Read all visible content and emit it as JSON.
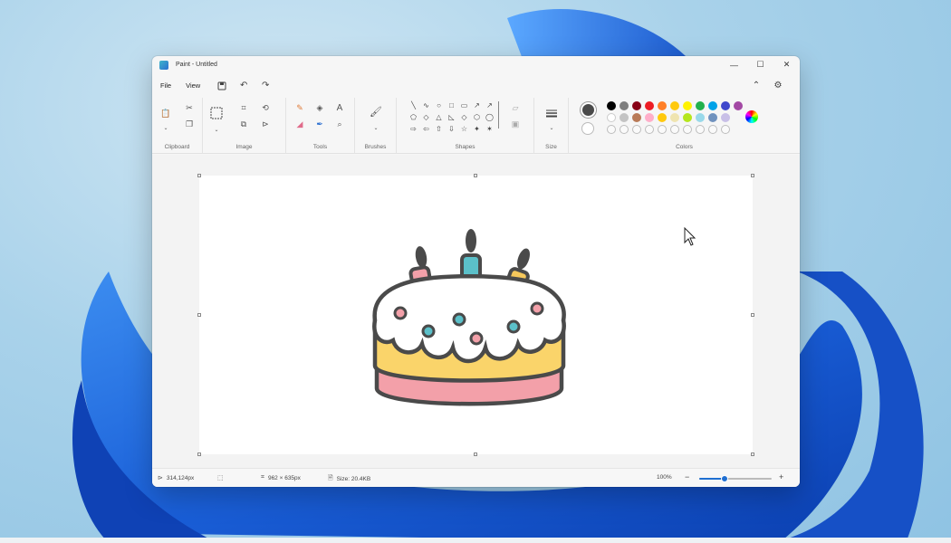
{
  "window": {
    "title": "Paint - Untitled"
  },
  "window_controls": {
    "minimize": "—",
    "maximize": "☐",
    "close": "✕"
  },
  "menu": {
    "items": [
      "File",
      "View"
    ]
  },
  "ribbon": {
    "groups": [
      "Clipboard",
      "Image",
      "Tools",
      "Brushes",
      "Shapes",
      "Size",
      "Colors"
    ],
    "shapes": [
      "╲",
      "∿",
      "○",
      "□",
      "▭",
      "↗",
      "↗",
      "⬠",
      "◇",
      "△",
      "◺",
      "◇",
      "⬡",
      "◯",
      "⇨",
      "⇦",
      "⇧",
      "⇩",
      "☆",
      "✦",
      "✶"
    ]
  },
  "colors": {
    "primary": "#4a4a4a",
    "secondary": "#ffffff",
    "palette_row1": [
      "#000000",
      "#7f7f7f",
      "#880015",
      "#ed1c24",
      "#ff7f27",
      "#ffc90e",
      "#fff200",
      "#22b14c",
      "#00a2e8",
      "#3f48cc",
      "#a349a4"
    ],
    "palette_row2": [
      "#ffffff",
      "#c3c3c3",
      "#b97a57",
      "#ffaec9",
      "#ffc90e",
      "#efe4b0",
      "#b5e61d",
      "#99d9ea",
      "#7092be",
      "#c8bfe7"
    ]
  },
  "canvas": {
    "cake": {
      "outline": "#4a4a4a",
      "frosting": "#ffffff",
      "cake_body": "#fad46a",
      "base": "#f3a0a9",
      "candle_colors": [
        "#f3a0a9",
        "#5bc0c9",
        "#f6c85b"
      ],
      "sprinkle_colors": [
        "#f3a0a9",
        "#5bc0c9"
      ]
    }
  },
  "status": {
    "cursor_pos": "314,124px",
    "canvas_size": "962 × 635px",
    "file_size": "Size: 20.4KB",
    "zoom": "100%",
    "zoom_level": 0.35
  }
}
